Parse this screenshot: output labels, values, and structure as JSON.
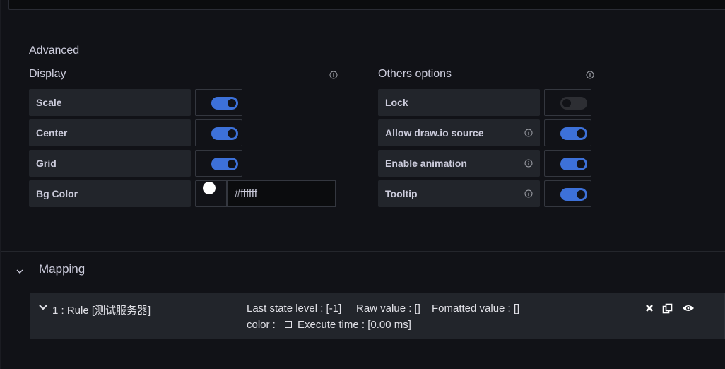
{
  "display": {
    "advanced_title": "Advanced",
    "display_title": "Display",
    "others_title": "Others options",
    "left_rows": [
      {
        "label": "Scale",
        "toggle": true
      },
      {
        "label": "Center",
        "toggle": true
      },
      {
        "label": "Grid",
        "toggle": true
      }
    ],
    "bg_color": {
      "label": "Bg Color",
      "value": "#ffffff"
    },
    "right_rows": [
      {
        "label": "Lock",
        "toggle": false,
        "info": false
      },
      {
        "label": "Allow draw.io source",
        "toggle": true,
        "info": true
      },
      {
        "label": "Enable animation",
        "toggle": true,
        "info": true
      },
      {
        "label": "Tooltip",
        "toggle": true,
        "info": true
      }
    ]
  },
  "mapping": {
    "title": "Mapping",
    "rule": {
      "title": "1 : Rule [测试服务器]",
      "last_state": "Last state level : [-1]",
      "raw_value": "Raw value : []",
      "formatted_value": "Fomatted value : []",
      "color_label": "color :",
      "execute_time": "Execute time : [0.00 ms]"
    },
    "actions": [
      "delete-icon",
      "duplicate-icon",
      "view-icon"
    ]
  },
  "colors": {
    "accent": "#3d71d9",
    "background": "#111217",
    "row_bg": "#22252b"
  }
}
